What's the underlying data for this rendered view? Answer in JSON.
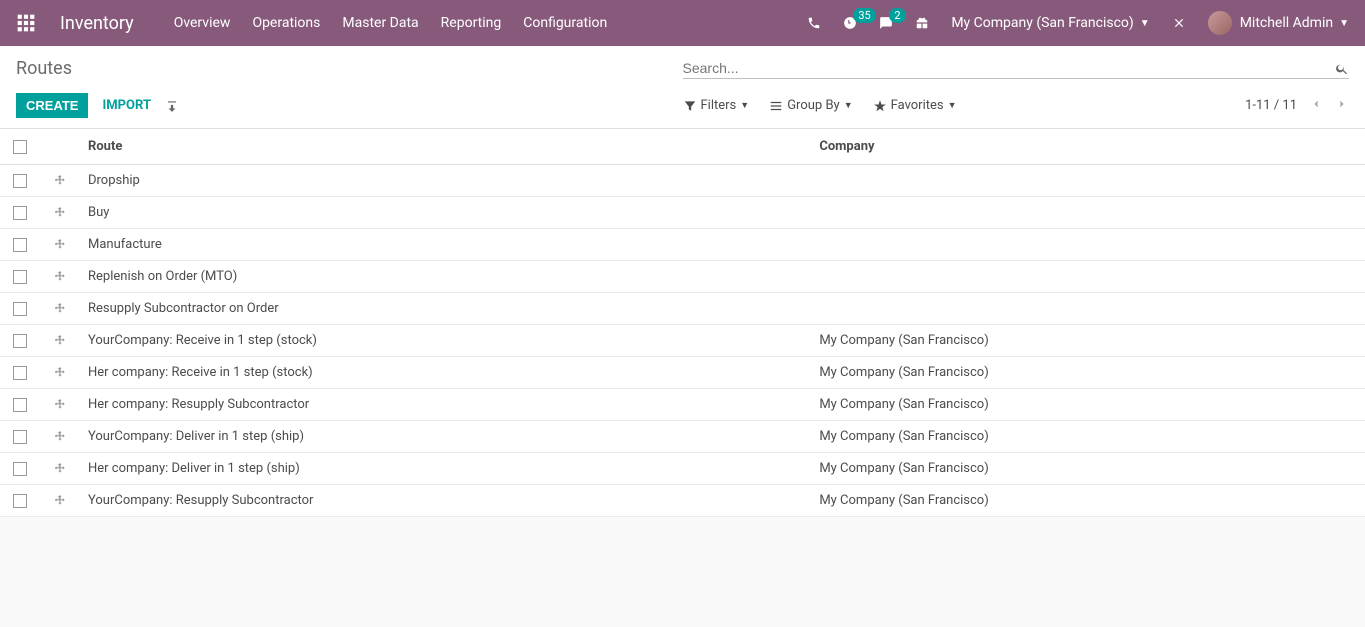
{
  "navbar": {
    "brand": "Inventory",
    "menu": [
      "Overview",
      "Operations",
      "Master Data",
      "Reporting",
      "Configuration"
    ],
    "badge_activity": "35",
    "badge_discuss": "2",
    "company": "My Company (San Francisco)",
    "user": "Mitchell Admin"
  },
  "breadcrumb": "Routes",
  "search_placeholder": "Search...",
  "buttons": {
    "create": "CREATE",
    "import": "IMPORT"
  },
  "filters": {
    "filters": "Filters",
    "groupby": "Group By",
    "favorites": "Favorites"
  },
  "pager": "1-11 / 11",
  "columns": {
    "route": "Route",
    "company": "Company"
  },
  "rows": [
    {
      "route": "Dropship",
      "company": ""
    },
    {
      "route": "Buy",
      "company": ""
    },
    {
      "route": "Manufacture",
      "company": ""
    },
    {
      "route": "Replenish on Order (MTO)",
      "company": ""
    },
    {
      "route": "Resupply Subcontractor on Order",
      "company": ""
    },
    {
      "route": "YourCompany: Receive in 1 step (stock)",
      "company": "My Company (San Francisco)"
    },
    {
      "route": "Her company: Receive in 1 step (stock)",
      "company": "My Company (San Francisco)"
    },
    {
      "route": "Her company: Resupply Subcontractor",
      "company": "My Company (San Francisco)"
    },
    {
      "route": "YourCompany: Deliver in 1 step (ship)",
      "company": "My Company (San Francisco)"
    },
    {
      "route": "Her company: Deliver in 1 step (ship)",
      "company": "My Company (San Francisco)"
    },
    {
      "route": "YourCompany: Resupply Subcontractor",
      "company": "My Company (San Francisco)"
    }
  ]
}
